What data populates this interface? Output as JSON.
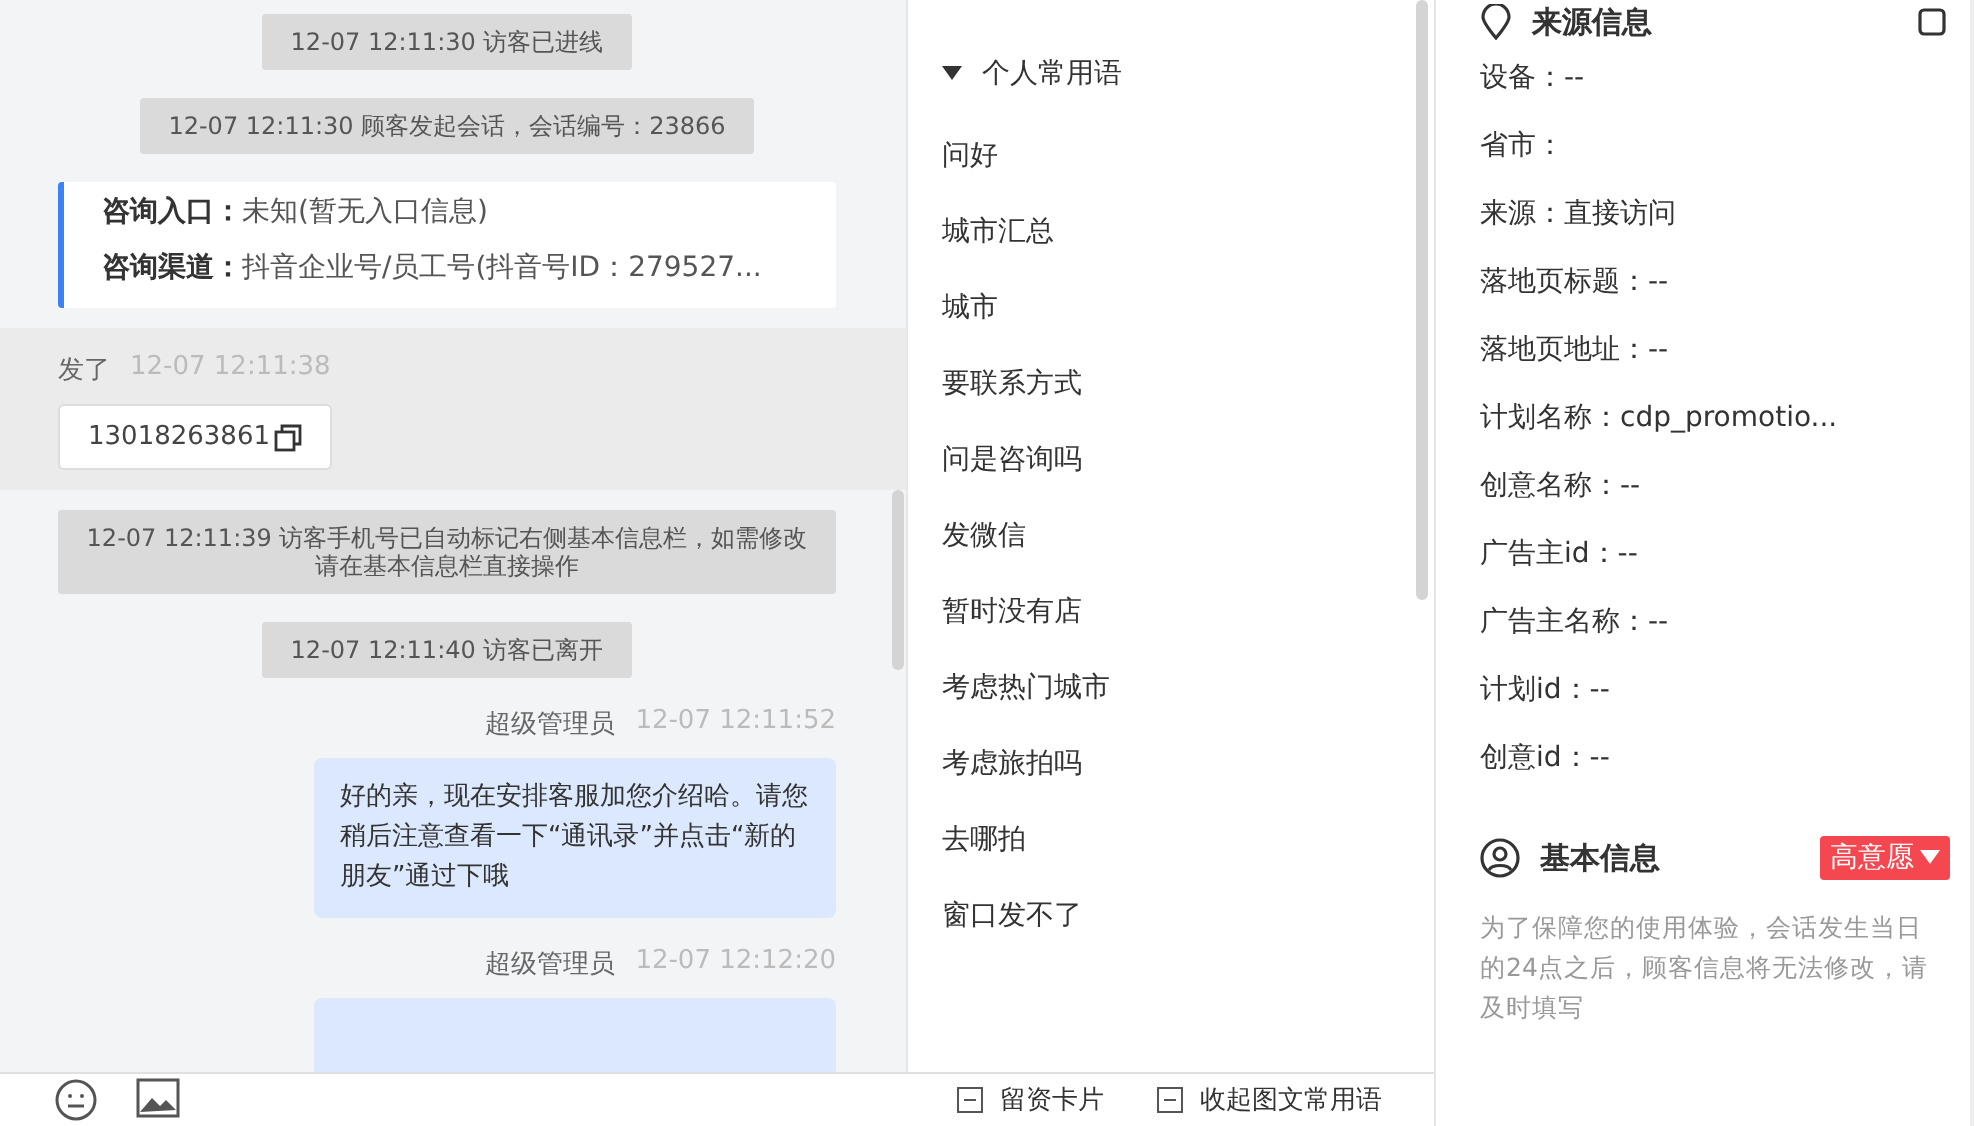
{
  "chat": {
    "messages": [
      {
        "kind": "system",
        "text": "12-07 12:11:30 访客已进线"
      },
      {
        "kind": "system",
        "text": "12-07 12:11:30 顾客发起会话，会话编号：23866"
      },
      {
        "kind": "entry",
        "lines": [
          {
            "label": "咨询入口：",
            "value": "未知(暂无入口信息)"
          },
          {
            "label": "咨询渠道：",
            "value": "抖音企业号/员工号(抖音号ID：279527..."
          }
        ]
      },
      {
        "kind": "visitor",
        "name": "发了",
        "time": "12-07 12:11:38",
        "text": "13018263861"
      },
      {
        "kind": "system",
        "text": "12-07 12:11:39 访客手机号已自动标记右侧基本信息栏，如需修改请在基本信息栏直接操作"
      },
      {
        "kind": "system",
        "text": "12-07 12:11:40 访客已离开"
      },
      {
        "kind": "agent",
        "name": "超级管理员",
        "time": "12-07 12:11:52",
        "text": "好的亲，现在安排客服加您介绍哈。请您稍后注意查看一下“通讯录”并点击“新的朋友”通过下哦"
      },
      {
        "kind": "agent",
        "name": "超级管理员",
        "time": "12-07 12:12:20"
      }
    ]
  },
  "phrases": {
    "group": "个人常用语",
    "expanded": true,
    "items": [
      "问好",
      "城市汇总",
      "城市",
      "要联系方式",
      "问是咨询吗",
      "发微信",
      "暂时没有店",
      "考虑热门城市",
      "考虑旅拍吗",
      "去哪拍",
      "窗口发不了"
    ]
  },
  "toolbar": {
    "actions": [
      "留资卡片",
      "收起图文常用语"
    ]
  },
  "source_info": {
    "title": "来源信息",
    "fields": [
      "设备：--",
      "省市：",
      "来源：直接访问",
      "落地页标题：--",
      "落地页地址：--",
      "计划名称：cdp_promotio...",
      "创意名称：--",
      "广告主id：--",
      "广告主名称：--",
      "计划id：--",
      "创意id：--"
    ]
  },
  "basic_info": {
    "title": "基本信息",
    "badge": "高意愿",
    "notice": "为了保障您的使用体验，会话发生当日的24点之后，顾客信息将无法修改，请及时填写"
  }
}
